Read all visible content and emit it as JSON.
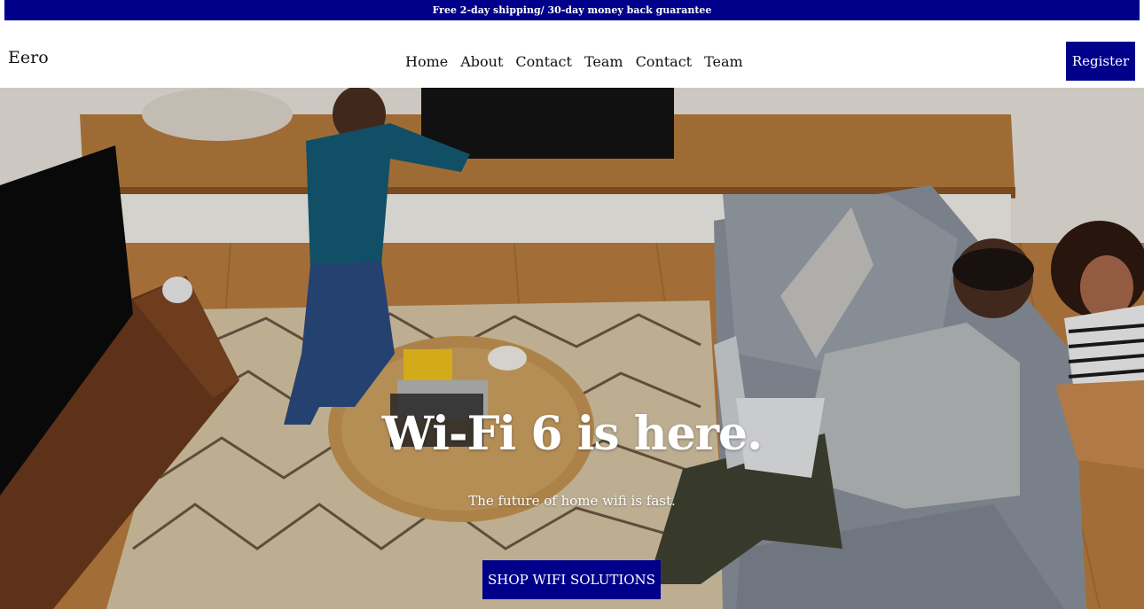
{
  "announcement": "Free 2-day shipping/ 30-day money back guarantee",
  "header": {
    "logo": "Eero",
    "nav": [
      "Home",
      "About",
      "Contact",
      "Team",
      "Contact",
      "Team"
    ],
    "register_label": "Register"
  },
  "hero": {
    "title": "Wi-Fi 6 is here.",
    "subtitle": "The future of home wifi is fast.",
    "cta_label": "SHOP WIFI SOLUTIONS",
    "image_icon": "family-living-room-photo"
  },
  "colors": {
    "brand": "#00008b",
    "text_dark": "#111111",
    "white": "#ffffff"
  }
}
